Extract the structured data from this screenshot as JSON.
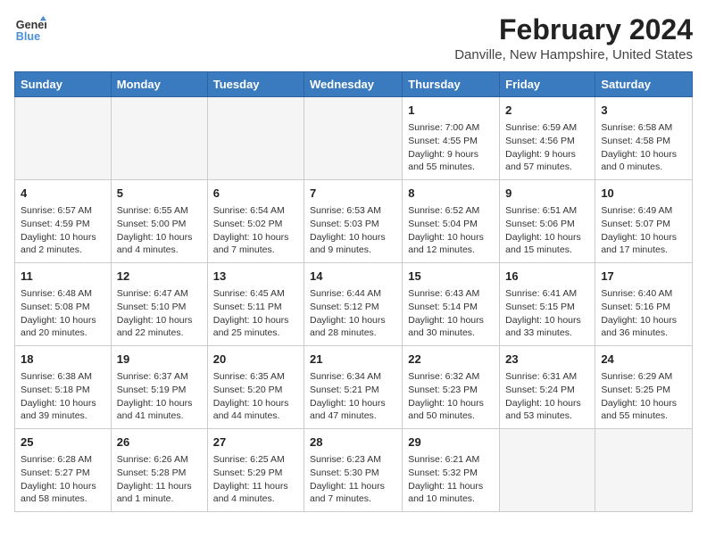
{
  "logo": {
    "line1": "General",
    "line2": "Blue"
  },
  "title": "February 2024",
  "subtitle": "Danville, New Hampshire, United States",
  "days_of_week": [
    "Sunday",
    "Monday",
    "Tuesday",
    "Wednesday",
    "Thursday",
    "Friday",
    "Saturday"
  ],
  "weeks": [
    [
      {
        "day": "",
        "info": ""
      },
      {
        "day": "",
        "info": ""
      },
      {
        "day": "",
        "info": ""
      },
      {
        "day": "",
        "info": ""
      },
      {
        "day": "1",
        "info": "Sunrise: 7:00 AM\nSunset: 4:55 PM\nDaylight: 9 hours and 55 minutes."
      },
      {
        "day": "2",
        "info": "Sunrise: 6:59 AM\nSunset: 4:56 PM\nDaylight: 9 hours and 57 minutes."
      },
      {
        "day": "3",
        "info": "Sunrise: 6:58 AM\nSunset: 4:58 PM\nDaylight: 10 hours and 0 minutes."
      }
    ],
    [
      {
        "day": "4",
        "info": "Sunrise: 6:57 AM\nSunset: 4:59 PM\nDaylight: 10 hours and 2 minutes."
      },
      {
        "day": "5",
        "info": "Sunrise: 6:55 AM\nSunset: 5:00 PM\nDaylight: 10 hours and 4 minutes."
      },
      {
        "day": "6",
        "info": "Sunrise: 6:54 AM\nSunset: 5:02 PM\nDaylight: 10 hours and 7 minutes."
      },
      {
        "day": "7",
        "info": "Sunrise: 6:53 AM\nSunset: 5:03 PM\nDaylight: 10 hours and 9 minutes."
      },
      {
        "day": "8",
        "info": "Sunrise: 6:52 AM\nSunset: 5:04 PM\nDaylight: 10 hours and 12 minutes."
      },
      {
        "day": "9",
        "info": "Sunrise: 6:51 AM\nSunset: 5:06 PM\nDaylight: 10 hours and 15 minutes."
      },
      {
        "day": "10",
        "info": "Sunrise: 6:49 AM\nSunset: 5:07 PM\nDaylight: 10 hours and 17 minutes."
      }
    ],
    [
      {
        "day": "11",
        "info": "Sunrise: 6:48 AM\nSunset: 5:08 PM\nDaylight: 10 hours and 20 minutes."
      },
      {
        "day": "12",
        "info": "Sunrise: 6:47 AM\nSunset: 5:10 PM\nDaylight: 10 hours and 22 minutes."
      },
      {
        "day": "13",
        "info": "Sunrise: 6:45 AM\nSunset: 5:11 PM\nDaylight: 10 hours and 25 minutes."
      },
      {
        "day": "14",
        "info": "Sunrise: 6:44 AM\nSunset: 5:12 PM\nDaylight: 10 hours and 28 minutes."
      },
      {
        "day": "15",
        "info": "Sunrise: 6:43 AM\nSunset: 5:14 PM\nDaylight: 10 hours and 30 minutes."
      },
      {
        "day": "16",
        "info": "Sunrise: 6:41 AM\nSunset: 5:15 PM\nDaylight: 10 hours and 33 minutes."
      },
      {
        "day": "17",
        "info": "Sunrise: 6:40 AM\nSunset: 5:16 PM\nDaylight: 10 hours and 36 minutes."
      }
    ],
    [
      {
        "day": "18",
        "info": "Sunrise: 6:38 AM\nSunset: 5:18 PM\nDaylight: 10 hours and 39 minutes."
      },
      {
        "day": "19",
        "info": "Sunrise: 6:37 AM\nSunset: 5:19 PM\nDaylight: 10 hours and 41 minutes."
      },
      {
        "day": "20",
        "info": "Sunrise: 6:35 AM\nSunset: 5:20 PM\nDaylight: 10 hours and 44 minutes."
      },
      {
        "day": "21",
        "info": "Sunrise: 6:34 AM\nSunset: 5:21 PM\nDaylight: 10 hours and 47 minutes."
      },
      {
        "day": "22",
        "info": "Sunrise: 6:32 AM\nSunset: 5:23 PM\nDaylight: 10 hours and 50 minutes."
      },
      {
        "day": "23",
        "info": "Sunrise: 6:31 AM\nSunset: 5:24 PM\nDaylight: 10 hours and 53 minutes."
      },
      {
        "day": "24",
        "info": "Sunrise: 6:29 AM\nSunset: 5:25 PM\nDaylight: 10 hours and 55 minutes."
      }
    ],
    [
      {
        "day": "25",
        "info": "Sunrise: 6:28 AM\nSunset: 5:27 PM\nDaylight: 10 hours and 58 minutes."
      },
      {
        "day": "26",
        "info": "Sunrise: 6:26 AM\nSunset: 5:28 PM\nDaylight: 11 hours and 1 minute."
      },
      {
        "day": "27",
        "info": "Sunrise: 6:25 AM\nSunset: 5:29 PM\nDaylight: 11 hours and 4 minutes."
      },
      {
        "day": "28",
        "info": "Sunrise: 6:23 AM\nSunset: 5:30 PM\nDaylight: 11 hours and 7 minutes."
      },
      {
        "day": "29",
        "info": "Sunrise: 6:21 AM\nSunset: 5:32 PM\nDaylight: 11 hours and 10 minutes."
      },
      {
        "day": "",
        "info": ""
      },
      {
        "day": "",
        "info": ""
      }
    ]
  ]
}
